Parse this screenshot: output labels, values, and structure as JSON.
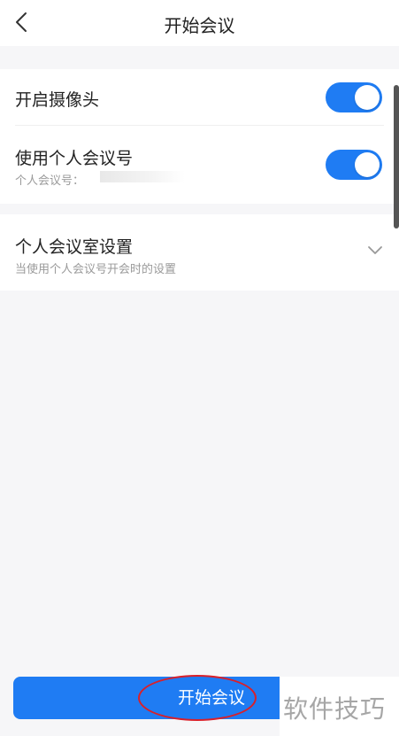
{
  "header": {
    "title": "开始会议",
    "back_icon": "chevron-left-icon"
  },
  "settings": {
    "camera": {
      "label": "开启摄像头",
      "enabled": true
    },
    "personal_meeting_id": {
      "label": "使用个人会议号",
      "sub_label": "个人会议号：",
      "enabled": true
    },
    "personal_room": {
      "label": "个人会议室设置",
      "sub_label": "当使用个人会议号开会时的设置",
      "expand_icon": "chevron-down-icon"
    }
  },
  "footer": {
    "start_button_label": "开始会议"
  },
  "watermark": {
    "text": "软件技巧"
  },
  "colors": {
    "accent": "#1f7cf3",
    "annotation": "#d9202a",
    "background": "#f6f6f8"
  }
}
